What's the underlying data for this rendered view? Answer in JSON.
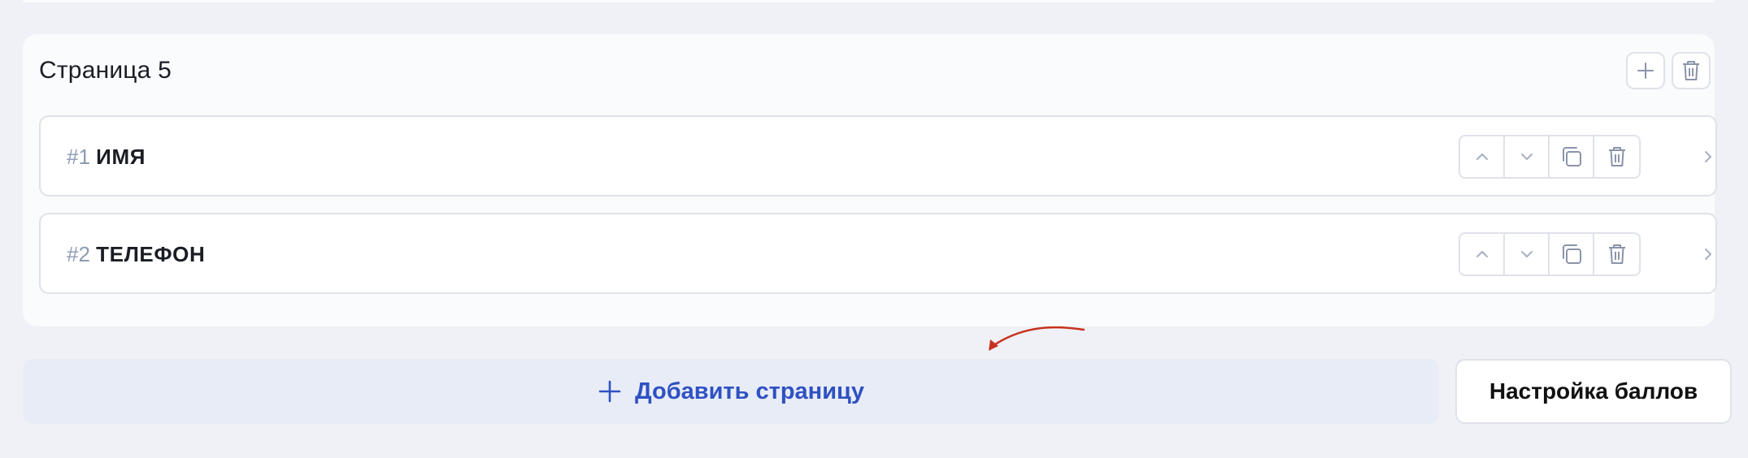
{
  "page": {
    "title": "Страница 5"
  },
  "fields": [
    {
      "number": "#1",
      "name": "ИМЯ"
    },
    {
      "number": "#2",
      "name": "ТЕЛЕФОН"
    }
  ],
  "actions": {
    "add_page_label": "Добавить страницу",
    "scores_label": "Настройка баллов"
  },
  "icons": {
    "add": "plus-icon",
    "delete": "trash-icon",
    "move_up": "chevron-up-icon",
    "move_down": "chevron-down-icon",
    "duplicate": "copy-icon",
    "expand": "chevron-right-icon"
  },
  "colors": {
    "accent": "#2f51c2",
    "annotation_arrow": "#c8321f",
    "icon_muted": "#a7b0c2"
  }
}
